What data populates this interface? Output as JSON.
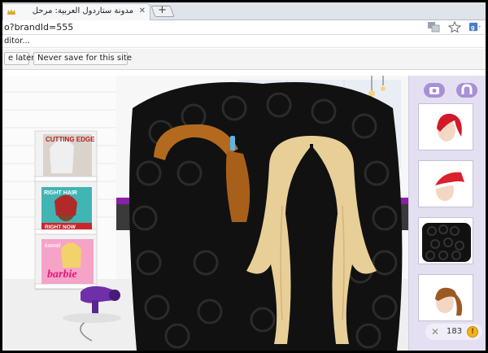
{
  "browser": {
    "tab": {
      "title": "مدونة ستاردول العربية: مرحل",
      "close_glyph": "✕"
    },
    "new_tab_glyph": "+",
    "address": {
      "url": "o?brandId=555"
    },
    "toolbar_icons": [
      "translate-icon",
      "bookmark-star-icon",
      "google-extension-icon"
    ],
    "bookmarks_bar": {
      "item": "ditor..."
    },
    "password_infobar": {
      "later_label": "e later",
      "never_label": "Never save for this site"
    }
  },
  "game": {
    "magazines": [
      {
        "title": "CUTTING EDGE"
      },
      {
        "title": "RIGHT HAIR",
        "subtitle": "RIGHT NOW"
      },
      {
        "title": "kawaii",
        "subtitle": "barbie"
      }
    ],
    "panel": {
      "buttons": [
        "camera-icon",
        "magnet-icon"
      ],
      "thumbnails": [
        "red-wavy-hair",
        "red-santa-hat-hair",
        "black-curly-hair",
        "brown-ponytail-hair"
      ],
      "coins": "183",
      "coin_glyph": "!",
      "close_glyph": "✕"
    },
    "colors": {
      "background_wall": "#ffffff",
      "curly_hair": "#111111",
      "blonde_hair": "#e8cf98",
      "brown_hair": "#b46a1e",
      "panel_bg": "#e4e0f1",
      "panel_button": "#a88fd8",
      "coin": "#f2b31c"
    }
  }
}
